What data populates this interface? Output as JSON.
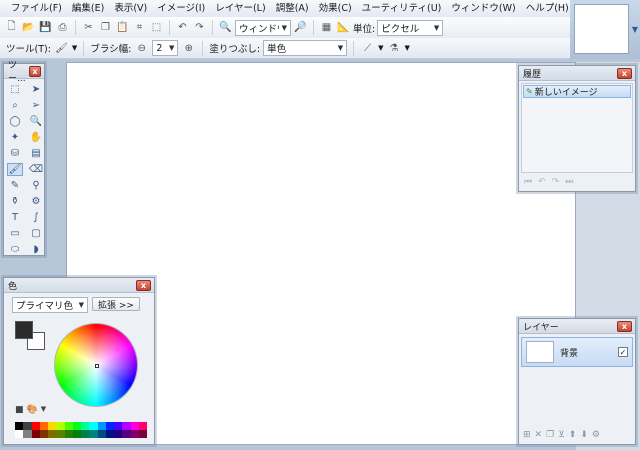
{
  "menu": [
    "ファイル(F)",
    "編集(E)",
    "表示(V)",
    "イメージ(I)",
    "レイヤー(L)",
    "調整(A)",
    "効果(C)",
    "ユーティリティ(U)",
    "ウィンドウ(W)",
    "ヘルプ(H)"
  ],
  "toolbar": {
    "zoom_value": "ウィンドウ",
    "unit_label": "単位:",
    "unit_value": "ピクセル"
  },
  "toolbar2": {
    "tool_label": "ツール(T):",
    "brush_label": "ブラシ幅:",
    "brush_value": "2",
    "fill_label": "塗りつぶし:",
    "fill_value": "単色"
  },
  "tools_panel": {
    "title": "ツー..."
  },
  "history_panel": {
    "title": "履歴",
    "items": [
      "新しいイメージ"
    ]
  },
  "layers_panel": {
    "title": "レイヤー",
    "layers": [
      "背景"
    ]
  },
  "colors_panel": {
    "title": "色",
    "mode_value": "プライマリ色",
    "more_label": "拡張 >>",
    "primary_color": "#2b2b2b",
    "secondary_color": "#ffffff"
  },
  "palette": [
    "#000000",
    "#404040",
    "#ff0000",
    "#ff6a00",
    "#ffd800",
    "#b6ff00",
    "#4cff00",
    "#00ff21",
    "#00ff90",
    "#00ffff",
    "#0094ff",
    "#0026ff",
    "#4800ff",
    "#b200ff",
    "#ff00dc",
    "#ff006e",
    "#ffffff",
    "#808080",
    "#7f0000",
    "#7f3300",
    "#7f6a00",
    "#5b7f00",
    "#267f00",
    "#007f0e",
    "#007f46",
    "#007f7f",
    "#004a7f",
    "#00137f",
    "#21007f",
    "#57007f",
    "#7f006e",
    "#7f0037"
  ]
}
